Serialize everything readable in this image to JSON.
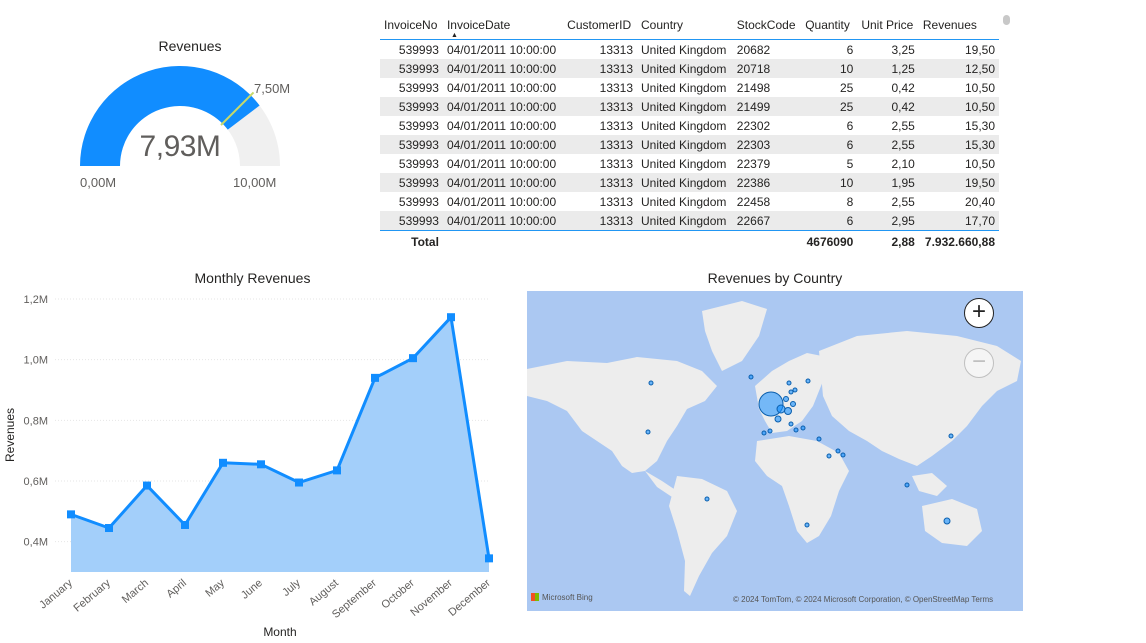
{
  "gauge": {
    "title": "Revenues",
    "value_label": "7,93M",
    "min_label": "0,00M",
    "max_label": "10,00M",
    "target_label": "7,50M",
    "value": 7.93,
    "min": 0,
    "max": 10,
    "target": 7.5,
    "fill_color": "#118dff",
    "track_color": "#f0f0f0",
    "target_color": "#c6d96a"
  },
  "table": {
    "columns": [
      "InvoiceNo",
      "InvoiceDate",
      "CustomerID",
      "Country",
      "StockCode",
      "Quantity",
      "Unit Price",
      "Revenues"
    ],
    "sorted_column": "InvoiceDate",
    "rows": [
      [
        "539993",
        "04/01/2011 10:00:00",
        "13313",
        "United Kingdom",
        "20682",
        "6",
        "3,25",
        "19,50"
      ],
      [
        "539993",
        "04/01/2011 10:00:00",
        "13313",
        "United Kingdom",
        "20718",
        "10",
        "1,25",
        "12,50"
      ],
      [
        "539993",
        "04/01/2011 10:00:00",
        "13313",
        "United Kingdom",
        "21498",
        "25",
        "0,42",
        "10,50"
      ],
      [
        "539993",
        "04/01/2011 10:00:00",
        "13313",
        "United Kingdom",
        "21499",
        "25",
        "0,42",
        "10,50"
      ],
      [
        "539993",
        "04/01/2011 10:00:00",
        "13313",
        "United Kingdom",
        "22302",
        "6",
        "2,55",
        "15,30"
      ],
      [
        "539993",
        "04/01/2011 10:00:00",
        "13313",
        "United Kingdom",
        "22303",
        "6",
        "2,55",
        "15,30"
      ],
      [
        "539993",
        "04/01/2011 10:00:00",
        "13313",
        "United Kingdom",
        "22379",
        "5",
        "2,10",
        "10,50"
      ],
      [
        "539993",
        "04/01/2011 10:00:00",
        "13313",
        "United Kingdom",
        "22386",
        "10",
        "1,95",
        "19,50"
      ],
      [
        "539993",
        "04/01/2011 10:00:00",
        "13313",
        "United Kingdom",
        "22458",
        "8",
        "2,55",
        "20,40"
      ],
      [
        "539993",
        "04/01/2011 10:00:00",
        "13313",
        "United Kingdom",
        "22667",
        "6",
        "2,95",
        "17,70"
      ]
    ],
    "total": {
      "label": "Total",
      "quantity": "4676090",
      "unit_price": "2,88",
      "revenues": "7.932.660,88"
    }
  },
  "chart_data": {
    "type": "area",
    "title": "Monthly Revenues",
    "xlabel": "Month",
    "ylabel": "Revenues",
    "categories": [
      "January",
      "February",
      "March",
      "April",
      "May",
      "June",
      "July",
      "August",
      "September",
      "October",
      "November",
      "December"
    ],
    "values": [
      0.49,
      0.445,
      0.585,
      0.455,
      0.66,
      0.655,
      0.595,
      0.635,
      0.94,
      1.005,
      1.14,
      0.345
    ],
    "y_ticks": [
      0.4,
      0.6,
      0.8,
      1.0,
      1.2
    ],
    "y_tick_labels": [
      "0,4M",
      "0,6M",
      "0,8M",
      "1,0M",
      "1,2M"
    ],
    "ylim": [
      0.3,
      1.2
    ],
    "grid": true,
    "line_color": "#118dff",
    "fill_color": "#a3cffa"
  },
  "map": {
    "title": "Revenues by Country",
    "zoom_in_label": "+",
    "zoom_out_label": "−",
    "logo_text": "Microsoft Bing",
    "credit_text": "© 2024 TomTom, © 2024 Microsoft Corporation, © OpenStreetMap  Terms",
    "water_color": "#abc8f2",
    "land_color": "#ededed",
    "bubble_color": "#118dff"
  }
}
